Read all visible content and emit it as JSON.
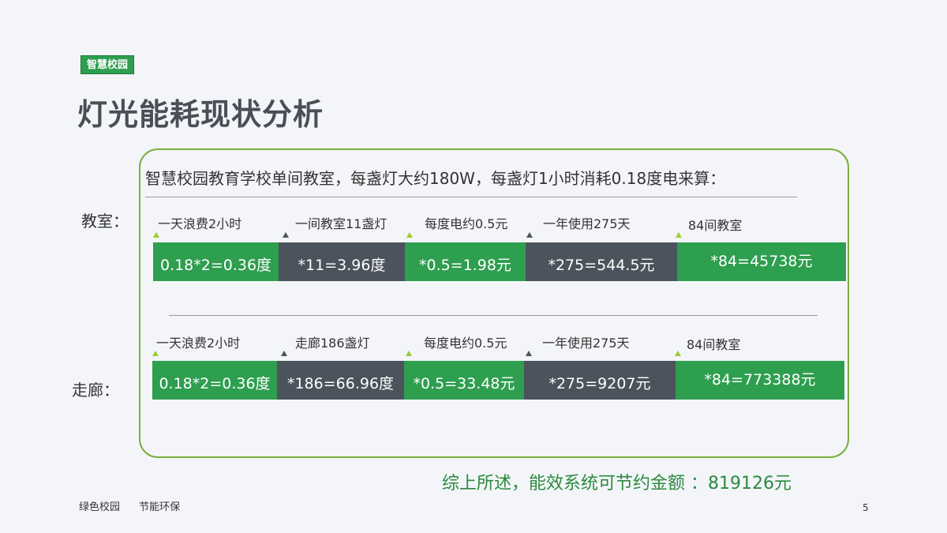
{
  "header": {
    "tag": "智慧校园",
    "title": "灯光能耗现状分析"
  },
  "intro": "智慧校园教育学校单间教室，每盏灯大约180W，每盏灯1小时消耗0.18度电来算：",
  "classroom": {
    "label": "教室：",
    "steps": [
      {
        "caption": "一天浪费2小时",
        "value": "0.18*2=0.36度"
      },
      {
        "caption": "一间教室11盏灯",
        "value": "*11=3.96度"
      },
      {
        "caption": "每度电约0.5元",
        "value": "*0.5=1.98元"
      },
      {
        "caption": "一年使用275天",
        "value": "*275=544.5元"
      },
      {
        "caption": "84间教室",
        "value": "*84=45738元"
      }
    ]
  },
  "corridor": {
    "label": "走廊：",
    "steps": [
      {
        "caption": "一天浪费2小时",
        "value": "0.18*2=0.36度"
      },
      {
        "caption": "走廊186盏灯",
        "value": "*186=66.96度"
      },
      {
        "caption": "每度电约0.5元",
        "value": "*0.5=33.48元"
      },
      {
        "caption": "一年使用275天",
        "value": "*275=9207元"
      },
      {
        "caption": "84间教室",
        "value": "*84=773388元"
      }
    ]
  },
  "summary": "综上所述，能效系统可节约金额 ：819126元",
  "footer": {
    "left": "绿色校园",
    "right": "节能环保"
  },
  "page_number": "5",
  "colors": {
    "green": "#2e9e4f",
    "dark": "#4b535c",
    "frame": "#7cae3e",
    "accent_triangle": "#9acd32"
  }
}
